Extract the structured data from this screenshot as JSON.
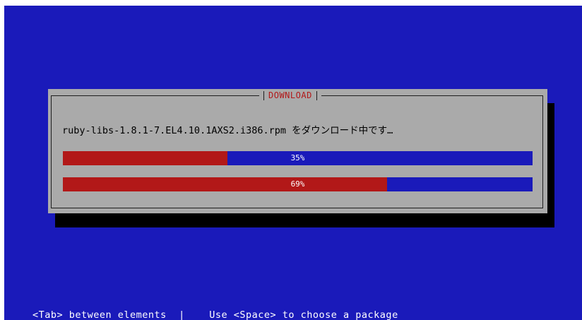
{
  "dialog": {
    "title": "DOWNLOAD",
    "message": "ruby-libs-1.8.1-7.EL4.10.1AXS2.i386.rpm をダウンロード中です…"
  },
  "progress_bars": [
    {
      "label": "35%",
      "value": 0.35
    },
    {
      "label": "69%",
      "value": 0.69
    }
  ],
  "help": {
    "left": "<Tab> between elements",
    "separator": "|",
    "right": "Use <Space> to choose a package"
  },
  "colors": {
    "background": "#1a1aba",
    "dialog": "#aaaaaa",
    "bar_fill": "#b21818",
    "bar_empty": "#1a1aba",
    "title": "#b21818"
  }
}
